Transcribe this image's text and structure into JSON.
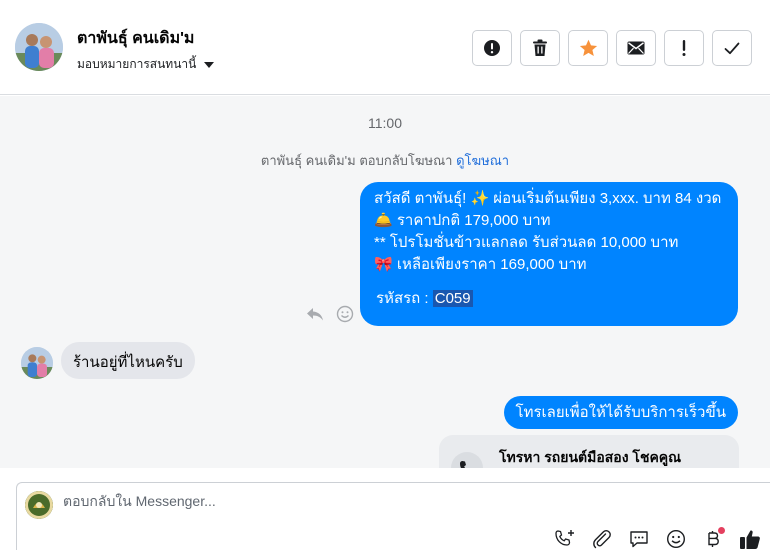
{
  "header": {
    "contact_name": "ตาพันธุ์ คนเดิม'ม",
    "assign_label": "มอบหมายการสนทนานี้",
    "actions": [
      {
        "name": "report-spam-button",
        "icon": "exclamation-circle-icon"
      },
      {
        "name": "delete-button",
        "icon": "trash-icon"
      },
      {
        "name": "star-button",
        "icon": "star-icon",
        "color": "#f7923b"
      },
      {
        "name": "mark-unread-button",
        "icon": "envelope-icon"
      },
      {
        "name": "follow-up-button",
        "icon": "exclamation-icon"
      },
      {
        "name": "mark-done-button",
        "icon": "checkmark-icon"
      }
    ]
  },
  "conversation": {
    "time": "11:00",
    "reply_note_prefix": "ตาพันธุ์ คนเดิม'ม ตอบกลับโฆษณา ",
    "reply_note_link": "ดูโฆษณา",
    "outgoing_1": {
      "lines": [
        "สวัสดี ตาพันธุ์! ✨  ผ่อนเริ่มต้นเพียง 3,xxx. บาท 84 งวด",
        "🛎️ ราคาปกติ 179,000 บาท",
        "** โปรโมชั่นข้าวแลกลด รับส่วนลด 10,000 บาท",
        "🎀  เหลือเพียงราคา 169,000 บาท"
      ],
      "code_label": "รหัสรถ : ",
      "code_value": "C059"
    },
    "incoming_1": "ร้านอยู่ที่ไหนครับ",
    "outgoing_2": "โทรเลยเพื่อให้ได้รับบริการเร็วขึ้น",
    "call_card_title": "โทรหา รถยนต์มือสอง โชคคูณ"
  },
  "composer": {
    "placeholder": "ตอบกลับใน Messenger...",
    "tools": [
      "add-call-icon",
      "paperclip-icon",
      "saved-replies-icon",
      "emoji-icon",
      "payment-icon",
      "thumbs-up-icon"
    ]
  },
  "colors": {
    "bubble_out": "#0084ff",
    "bubble_in": "#e4e6eb",
    "link": "#216fdb",
    "star": "#f7923b"
  }
}
